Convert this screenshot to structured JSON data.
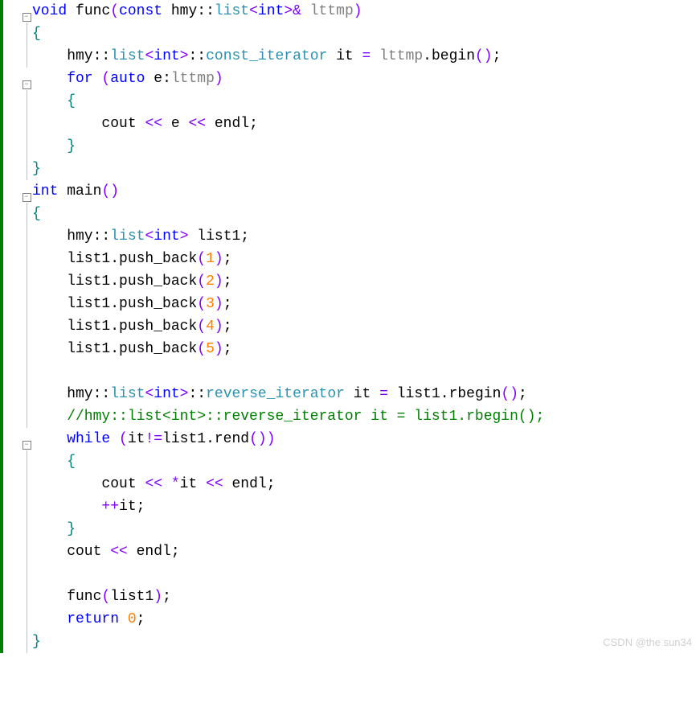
{
  "code": {
    "l1_void": "void",
    "l1_func": " func",
    "l1_paren1": "(",
    "l1_const": "const",
    "l1_hmy": " hmy",
    "l1_scope1": "::",
    "l1_list": "list",
    "l1_lt": "<",
    "l1_int": "int",
    "l1_gt": ">",
    "l1_amp": "&",
    "l1_lttmp": " lttmp",
    "l1_paren2": ")",
    "l2_brace": "{",
    "l3_hmy": "    hmy",
    "l3_scope1": "::",
    "l3_list": "list",
    "l3_lt": "<",
    "l3_int": "int",
    "l3_gt": ">",
    "l3_scope2": "::",
    "l3_ci": "const_iterator",
    "l3_it": " it ",
    "l3_eq": "=",
    "l3_lttmp": " lttmp",
    "l3_dot": ".",
    "l3_begin": "begin",
    "l3_paren": "()",
    "l3_semi": ";",
    "l4_for": "    for",
    "l4_paren1": " (",
    "l4_auto": "auto",
    "l4_e": " e",
    "l4_colon": ":",
    "l4_lttmp": "lttmp",
    "l4_paren2": ")",
    "l5_brace": "    {",
    "l6_cout": "        cout ",
    "l6_op1": "<<",
    "l6_e": " e ",
    "l6_op2": "<<",
    "l6_endl": " endl",
    "l6_semi": ";",
    "l7_brace": "    }",
    "l8_brace": "}",
    "l9_int": "int",
    "l9_main": " main",
    "l9_paren": "()",
    "l10_brace": "{",
    "l11_hmy": "    hmy",
    "l11_scope": "::",
    "l11_list": "list",
    "l11_lt": "<",
    "l11_int": "int",
    "l11_gt": ">",
    "l11_list1": " list1",
    "l11_semi": ";",
    "l12": "    list1",
    "l12_dot": ".",
    "l12_pb": "push_back",
    "l12_p1": "(",
    "l12_n": "1",
    "l12_p2": ")",
    "l12_semi": ";",
    "l13_n": "2",
    "l14_n": "3",
    "l15_n": "4",
    "l16_n": "5",
    "l18_hmy": "    hmy",
    "l18_scope1": "::",
    "l18_list": "list",
    "l18_lt": "<",
    "l18_int": "int",
    "l18_gt": ">",
    "l18_scope2": "::",
    "l18_ri": "reverse_iterator",
    "l18_it": " it ",
    "l18_eq": "=",
    "l18_list1": " list1",
    "l18_dot": ".",
    "l18_rbegin": "rbegin",
    "l18_paren": "()",
    "l18_semi": ";",
    "l19_comment": "    //hmy::list<int>::reverse_iterator it = list1.rbegin();",
    "l20_while": "    while",
    "l20_p1": " (",
    "l20_it": "it",
    "l20_ne": "!=",
    "l20_list1": "list1",
    "l20_dot": ".",
    "l20_rend": "rend",
    "l20_paren": "()",
    "l20_p2": ")",
    "l21_brace": "    {",
    "l22_cout": "        cout ",
    "l22_op1": "<<",
    "l22_star": " *",
    "l22_it": "it ",
    "l22_op2": "<<",
    "l22_endl": " endl",
    "l22_semi": ";",
    "l23_pp": "        ++",
    "l23_it": "it",
    "l23_semi": ";",
    "l24_brace": "    }",
    "l25_cout": "    cout ",
    "l25_op": "<<",
    "l25_endl": " endl",
    "l25_semi": ";",
    "l27_func": "    func",
    "l27_p1": "(",
    "l27_list1": "list1",
    "l27_p2": ")",
    "l27_semi": ";",
    "l28_return": "    return",
    "l28_zero": " 0",
    "l28_semi": ";",
    "l29_brace": "}"
  },
  "watermark": "CSDN @the sun34",
  "fold_minus": "−"
}
